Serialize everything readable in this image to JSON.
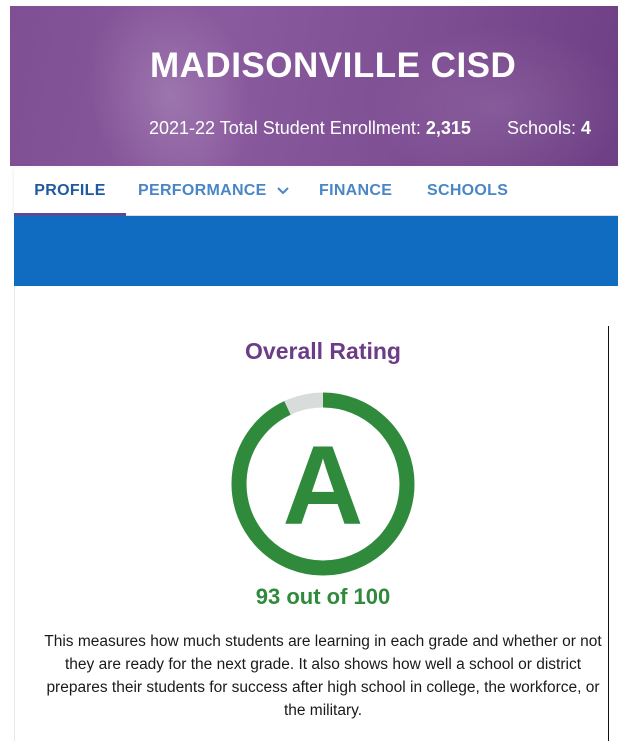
{
  "header": {
    "district_name": "MADISONVILLE CISD",
    "enrollment_label": "2021-22 Total Student Enrollment:",
    "enrollment_value": "2,315",
    "schools_label": "Schools:",
    "schools_value": "4"
  },
  "nav": {
    "tabs": [
      {
        "label": "PROFILE",
        "active": true
      },
      {
        "label": "PERFORMANCE",
        "has_dropdown": true
      },
      {
        "label": "FINANCE"
      },
      {
        "label": "SCHOOLS"
      }
    ]
  },
  "rating": {
    "title": "Overall Rating",
    "grade": "A",
    "score": 93,
    "max_score": 100,
    "score_text": "93 out of 100",
    "description": "This measures how much students are learning in each grade and whether or not they are ready for the next grade. It also shows how well a school or district prepares their students for success after high school in college, the workforce, or the military."
  },
  "colors": {
    "hero_purple": "#7f4f93",
    "title_purple": "#6d3c86",
    "tab_blue": "#4a86c5",
    "tab_active": "#1f5aa0",
    "band_blue": "#0f6cc0",
    "rating_green": "#2f8a3c",
    "gauge_track": "#d8dcdb"
  }
}
